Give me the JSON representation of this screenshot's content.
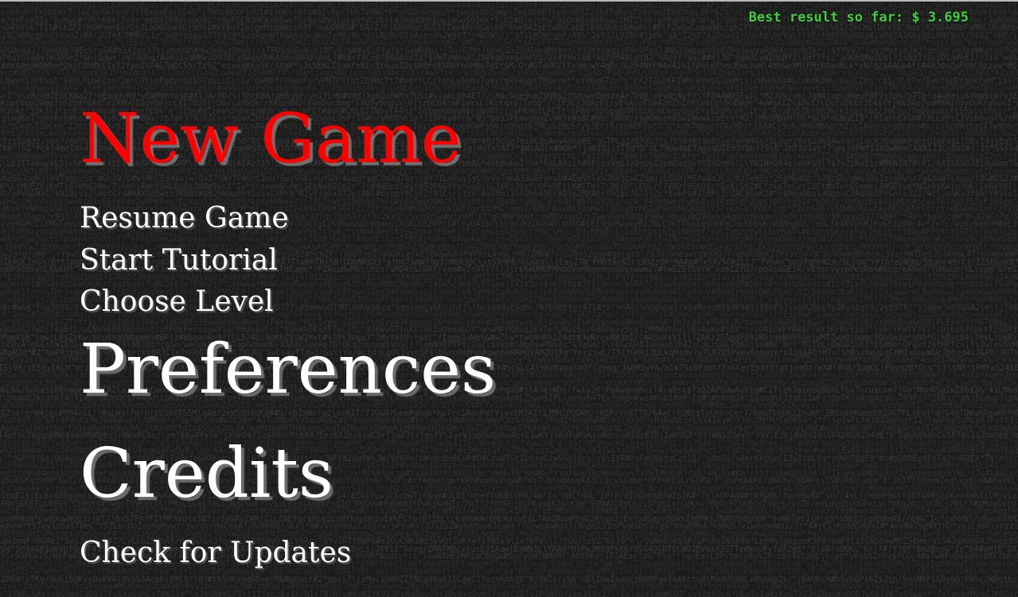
{
  "hud": {
    "best_result": "Best result so far: $ 3.695"
  },
  "menu": {
    "items": [
      {
        "id": "new-game",
        "label": "New Game",
        "selected": true
      },
      {
        "id": "resume-game",
        "label": "Resume Game",
        "selected": false
      },
      {
        "id": "start-tutorial",
        "label": "Start Tutorial",
        "selected": false
      },
      {
        "id": "choose-level",
        "label": "Choose Level",
        "selected": false
      },
      {
        "id": "preferences",
        "label": "Preferences",
        "selected": false
      },
      {
        "id": "credits",
        "label": "Credits",
        "selected": false
      },
      {
        "id": "check-for-updates",
        "label": "Check for Updates",
        "selected": false
      }
    ]
  },
  "colors": {
    "background": "#1c1c1c",
    "selected_item": "#ff0000",
    "menu_item": "#ffffff",
    "best_result": "#3fd23a",
    "matrix_text": "#3a3a3a"
  }
}
